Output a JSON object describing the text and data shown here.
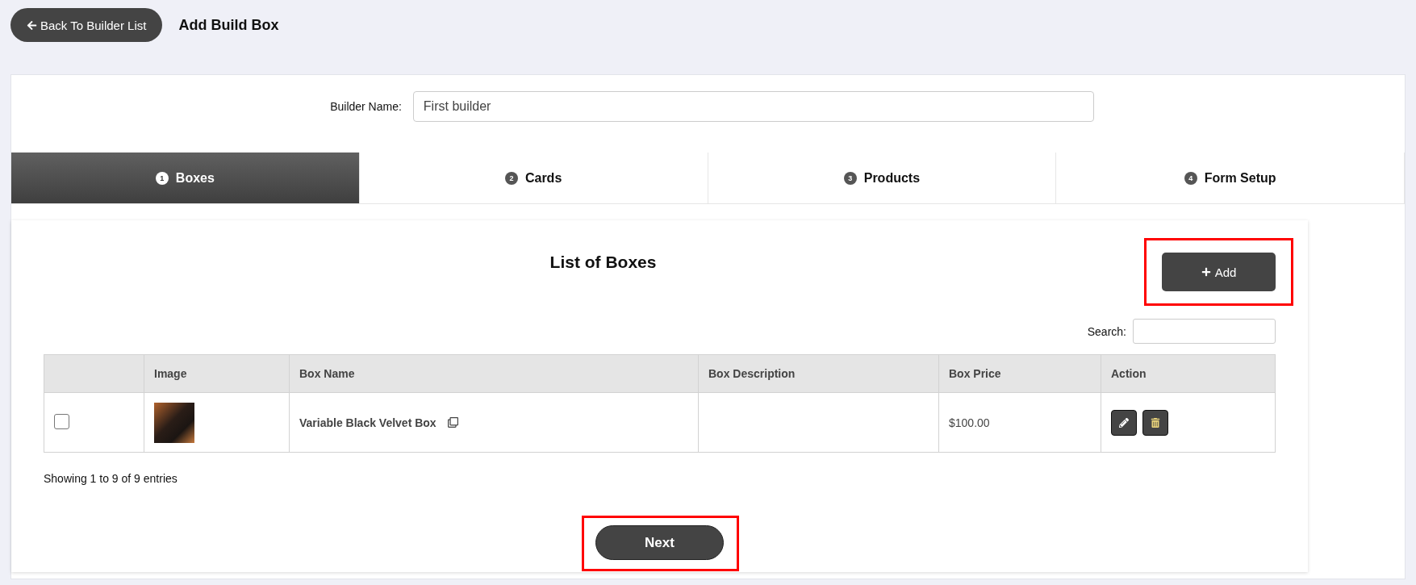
{
  "header": {
    "back_button": "Back To Builder List",
    "title": "Add Build Box"
  },
  "builder_name": {
    "label": "Builder Name:",
    "value": "First builder"
  },
  "tabs": [
    {
      "number": "1",
      "label": "Boxes",
      "selected": true
    },
    {
      "number": "2",
      "label": "Cards",
      "selected": false
    },
    {
      "number": "3",
      "label": "Products",
      "selected": false
    },
    {
      "number": "4",
      "label": "Form Setup",
      "selected": false
    }
  ],
  "list": {
    "title": "List of Boxes",
    "add_button": {
      "label": "Add",
      "highlighted": true
    },
    "search": {
      "label": "Search:"
    },
    "table": {
      "columns": [
        "",
        "Image",
        "Box Name",
        "Box Description",
        "Box Price",
        "Action"
      ],
      "rows": [
        {
          "checked": false,
          "box_name": "Variable Black Velvet Box",
          "box_description": "",
          "box_price": "$100.00"
        }
      ]
    },
    "info": "Showing 1 to 9 of 9 entries"
  },
  "next_button": {
    "label": "Next",
    "highlighted": true
  }
}
